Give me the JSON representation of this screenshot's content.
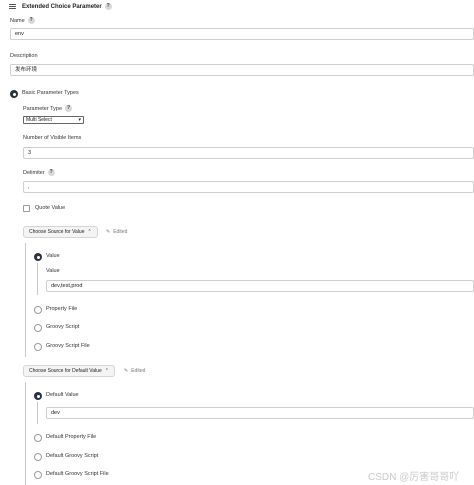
{
  "header": {
    "title": "Extended Choice Parameter",
    "help_glyph": "?"
  },
  "name": {
    "label": "Name",
    "help_glyph": "?",
    "value": "env"
  },
  "description": {
    "label": "Description",
    "value": "发布环境"
  },
  "basic": {
    "label": "Basic Parameter Types",
    "parameter_type": {
      "label": "Parameter Type",
      "help_glyph": "?",
      "selected": "Multi Select"
    },
    "visible_items": {
      "label": "Number of Visible Items",
      "value": "3"
    },
    "delimiter": {
      "label": "Delimiter",
      "help_glyph": "?",
      "value": ","
    },
    "quote_value": {
      "label": "Quote Value"
    },
    "source_value": {
      "button": "Choose Source for Value",
      "edited": "Edited",
      "options": [
        {
          "label": "Value",
          "selected": true
        },
        {
          "label": "Property File",
          "selected": false
        },
        {
          "label": "Groovy Script",
          "selected": false
        },
        {
          "label": "Groovy Script File",
          "selected": false
        }
      ],
      "value_label": "Value",
      "value": "dev,test,prod"
    },
    "source_default": {
      "button": "Choose Source for Default Value",
      "edited": "Edited",
      "options": [
        {
          "label": "Default Value",
          "selected": true
        },
        {
          "label": "Default Property File",
          "selected": false
        },
        {
          "label": "Default Groovy Script",
          "selected": false
        },
        {
          "label": "Default Groovy Script File",
          "selected": false
        }
      ],
      "value": "dev"
    }
  },
  "watermark": "CSDN @厉害哥哥吖"
}
